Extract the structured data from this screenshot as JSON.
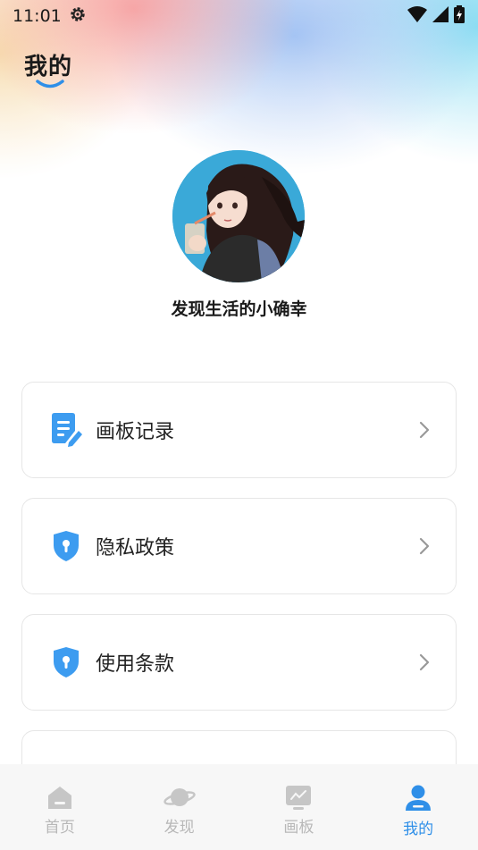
{
  "status_bar": {
    "time": "11:01"
  },
  "header": {
    "title": "我的"
  },
  "profile": {
    "username": "发现生活的小确幸"
  },
  "menu": {
    "items": [
      {
        "label": "画板记录",
        "icon": "document-edit-icon"
      },
      {
        "label": "隐私政策",
        "icon": "shield-lock-icon"
      },
      {
        "label": "使用条款",
        "icon": "shield-lock-icon"
      }
    ]
  },
  "nav": {
    "items": [
      {
        "label": "首页",
        "icon": "home-icon",
        "active": false
      },
      {
        "label": "发现",
        "icon": "planet-icon",
        "active": false
      },
      {
        "label": "画板",
        "icon": "board-icon",
        "active": false
      },
      {
        "label": "我的",
        "icon": "user-icon",
        "active": true
      }
    ]
  },
  "colors": {
    "accent": "#2f8fe8",
    "icon_blue": "#3d9cf0",
    "inactive": "#b8b8b8"
  }
}
